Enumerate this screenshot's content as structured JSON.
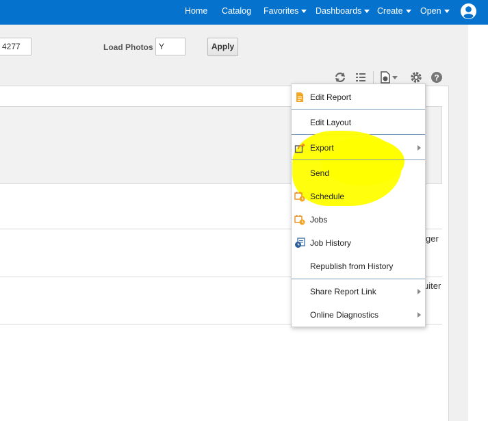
{
  "nav": {
    "home": "Home",
    "catalog": "Catalog",
    "favorites": "Favorites",
    "dashboards": "Dashboards",
    "create": "Create",
    "open": "Open"
  },
  "params": {
    "first_value": "4277",
    "load_photos_label": "Load Photos",
    "load_photos_value": "Y",
    "apply_label": "Apply"
  },
  "toolbar": {
    "icons": [
      "refresh-icon",
      "list-icon",
      "export-document-icon",
      "gear-icon",
      "help-icon"
    ]
  },
  "report": {
    "row1_text": "ger",
    "row2_text": "uiter"
  },
  "menu": {
    "items": [
      {
        "label": "Edit Report",
        "icon": "document-icon"
      },
      {
        "label": "Edit Layout",
        "icon": ""
      },
      {
        "label": "Export",
        "icon": "export-icon"
      },
      {
        "label": "Send",
        "icon": ""
      },
      {
        "label": "Schedule",
        "icon": "calendar-clock-icon"
      },
      {
        "label": "Jobs",
        "icon": "calendar-clock-icon"
      },
      {
        "label": "Job History",
        "icon": "job-history-icon"
      },
      {
        "label": "Republish from History",
        "icon": ""
      },
      {
        "label": "Share Report Link",
        "icon": ""
      },
      {
        "label": "Online Diagnostics",
        "icon": ""
      }
    ]
  },
  "colors": {
    "nav_bar": "#0572ce",
    "highlight": "#ffff00",
    "icon_orange": "#f5a623"
  }
}
